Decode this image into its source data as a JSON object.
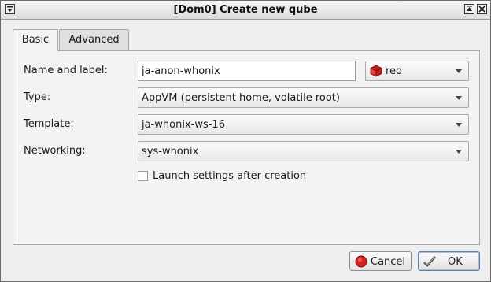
{
  "window": {
    "title": "[Dom0] Create new qube"
  },
  "tabs": [
    {
      "label": "Basic",
      "active": true
    },
    {
      "label": "Advanced",
      "active": false
    }
  ],
  "form": {
    "name_label": "Name and label:",
    "name_value": "ja-anon-whonix",
    "color_value": "red",
    "color_hex": "#c41d1d",
    "type_label": "Type:",
    "type_value": "AppVM (persistent home, volatile root)",
    "template_label": "Template:",
    "template_value": "ja-whonix-ws-16",
    "networking_label": "Networking:",
    "networking_value": "sys-whonix",
    "launch_settings_label": "Launch settings after creation",
    "launch_settings_checked": false
  },
  "buttons": {
    "cancel_label": "Cancel",
    "ok_label": "OK"
  }
}
